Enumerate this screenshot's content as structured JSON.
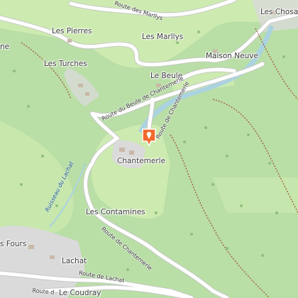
{
  "places": [
    {
      "id": "les-chosal",
      "text": "Les Chosal"
    },
    {
      "id": "les-pierres",
      "text": "Les Pierres"
    },
    {
      "id": "les-marllys",
      "text": "Les Marllys"
    },
    {
      "id": "maison-neuve",
      "text": "Maison Neuve"
    },
    {
      "id": "les-turches",
      "text": "Les Turches"
    },
    {
      "id": "le-beule",
      "text": "Le Beule"
    },
    {
      "id": "chantemerle",
      "text": "Chantemerle"
    },
    {
      "id": "les-contamines",
      "text": "Les Contamines"
    },
    {
      "id": "les-fours",
      "text": "s Fours"
    },
    {
      "id": "lachat",
      "text": "Lachat"
    },
    {
      "id": "le-coudray",
      "text": "Le Coudray"
    },
    {
      "id": "edge-ne",
      "text": "ne"
    }
  ],
  "roads": [
    {
      "id": "route-des-marllys",
      "text": "Route des Marllys"
    },
    {
      "id": "route-du-beule",
      "text": "Route du Beule de Chantemerle"
    },
    {
      "id": "route-de-chantemerle-n",
      "text": "Route de Chantemerle"
    },
    {
      "id": "route-de-chantemerle-s",
      "text": "Route de Chantemerle"
    },
    {
      "id": "route-de-lachat",
      "text": "Route de Lachat"
    },
    {
      "id": "route-edge",
      "text": "Route d"
    }
  ],
  "streams": [
    {
      "id": "ruisseau-du-lachat",
      "text": "Ruisseau du Lachat"
    }
  ],
  "marker": {
    "label": "Chantemerle",
    "icon": "pin-icon",
    "color": "#f26a2e"
  },
  "colors": {
    "forest": "#a9d496",
    "meadow": "#cdebb0",
    "urban": "#dadada",
    "water": "#aad3df",
    "road": "#ffffff"
  }
}
